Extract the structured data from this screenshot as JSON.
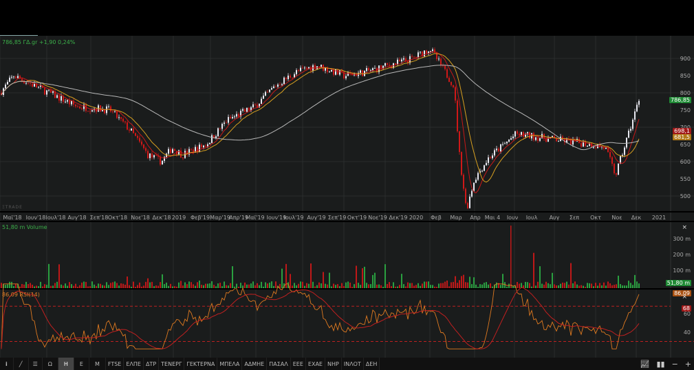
{
  "quote": {
    "text": "786,85 ΓΔ.gr +1,90 0,24%"
  },
  "watermark": "ΞTRADE",
  "price_axis": {
    "ticks": [
      "900",
      "850",
      "800",
      "750",
      "700",
      "650",
      "600",
      "550",
      "500"
    ],
    "tags": {
      "last": "786,85",
      "ma_red": "698,1",
      "ma_yellow": "681,5"
    }
  },
  "date_axis": [
    "Μαϊ'18",
    "Ιουν'18",
    "Ιουλ'18",
    "Αυγ'18",
    "Σεπ'18",
    "Οκτ'18",
    "Νοε'18",
    "Δεκ'18",
    "2019",
    "Φεβ'19",
    "Μαρ'19",
    "Απρ'19",
    "Μαϊ'19",
    "Ιουν'19",
    "Ιουλ'19",
    "Αυγ'19",
    "Σεπ'19",
    "Οκτ'19",
    "Νοε'19",
    "Δεκ'19",
    "2020",
    "Φεβ",
    "Μαρ",
    "Απρ",
    "Μαι 4",
    "Ιουν",
    "Ιουλ",
    "Αυγ",
    "Σεπ",
    "Οκτ",
    "Νοε",
    "Δεκ",
    "2021"
  ],
  "volume": {
    "label": "51,80 m Volume",
    "ticks": [
      "300 m",
      "200 m",
      "100 m"
    ],
    "tag": "51,80 m",
    "close": "×"
  },
  "rsi": {
    "label": "86,09 RSI(14)",
    "ticks": [
      "60",
      "40"
    ],
    "tag": "86,09",
    "level_tag": "68",
    "close": "×"
  },
  "toolbar": {
    "items": [
      "Ω",
      "Η",
      "Ε",
      "Μ",
      "FTSE",
      "ΕΛΠΕ",
      "ΔΤΡ",
      "ΤΕΝΕΡΓ",
      "ΓΕΚΤΕΡΝΑ",
      "ΜΠΕΛΑ",
      "ΑΔΜΗΕ",
      "ΠΑΣΑΛ",
      "ΕΕΕ",
      "ΕΧΑΕ",
      "ΝΗΡ",
      "ΙΝΛΟΤ",
      "ΔΕΗ"
    ],
    "active": "Η",
    "right": [
      "−",
      "+"
    ]
  },
  "colors": {
    "up": "#e8e8f0",
    "down": "#d01818",
    "ma_red": "#c81818",
    "ma_yellow": "#d8a020",
    "ma_grey": "#b8b8b8",
    "vol_up": "#2aa040",
    "vol_down": "#c01818",
    "rsi": "#e07a20"
  },
  "chart_data": {
    "type": "candlestick",
    "title": "ΓΔ.gr",
    "ylim": [
      460,
      940
    ],
    "x": [
      "Μαϊ'18",
      "Ιουν'18",
      "Αυγ'18",
      "Σεπ'18",
      "Οκτ'18",
      "Νοε'18",
      "Δεκ'18",
      "Ιαν'19",
      "Φεβ'19",
      "Μαρ'19",
      "Απρ'19",
      "Μαϊ'19",
      "Ιουν'19",
      "Αυγ'19",
      "Σεπ'19",
      "Οκτ'19",
      "Δεκ'19",
      "Ιαν'20",
      "Φεβ'20",
      "Μαρ'20 α",
      "Μαρ'20 β",
      "Απρ'20",
      "Μαι'20",
      "Ιουν'20",
      "Ιουλ'20",
      "Σεπ'20",
      "Οκτ'20",
      "Νοε'20 α",
      "Νοε'20 β",
      "Δεκ'20"
    ],
    "close": [
      800,
      850,
      760,
      755,
      750,
      690,
      620,
      600,
      640,
      620,
      650,
      720,
      760,
      820,
      860,
      880,
      850,
      860,
      900,
      930,
      820,
      620,
      460,
      550,
      610,
      680,
      650,
      640,
      560,
      787
    ]
  }
}
